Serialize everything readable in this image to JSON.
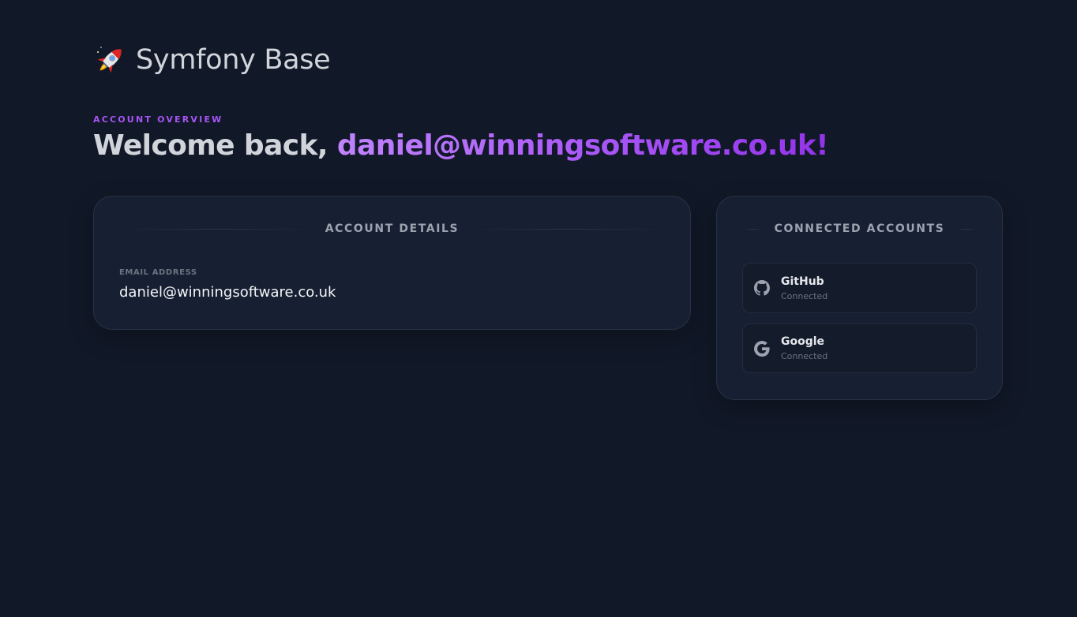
{
  "brand": {
    "icon": "rocket-emoji",
    "name": "Symfony Base"
  },
  "header": {
    "eyebrow": "ACCOUNT OVERVIEW",
    "greeting": "Welcome back, ",
    "user_email": "daniel@winningsoftware.co.uk!"
  },
  "account_details": {
    "title": "ACCOUNT DETAILS",
    "email_label": "EMAIL ADDRESS",
    "email_value": "daniel@winningsoftware.co.uk"
  },
  "connected_accounts": {
    "title": "CONNECTED ACCOUNTS",
    "providers": [
      {
        "name": "GitHub",
        "status": "Connected",
        "icon": "github-icon"
      },
      {
        "name": "Google",
        "status": "Connected",
        "icon": "google-icon"
      }
    ]
  },
  "colors": {
    "background": "#111827",
    "card": "#172033",
    "accent": "#a855f7",
    "accent_dark": "#9333ea"
  }
}
